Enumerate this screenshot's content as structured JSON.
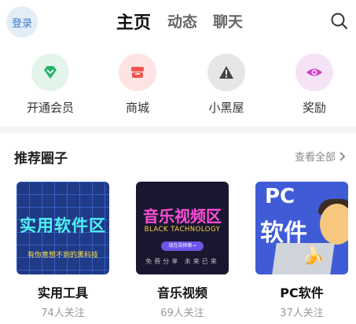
{
  "header": {
    "login_label": "登录",
    "tabs": [
      {
        "label": "主页",
        "active": true
      },
      {
        "label": "动态",
        "active": false
      },
      {
        "label": "聊天",
        "active": false
      }
    ],
    "search_icon": "search-icon"
  },
  "quick_actions": [
    {
      "label": "开通会员",
      "icon": "diamond-icon",
      "bg": "#e3f4ea",
      "color": "#27b36a"
    },
    {
      "label": "商城",
      "icon": "shop-icon",
      "bg": "#fde3e3",
      "color": "#f05454"
    },
    {
      "label": "小黑屋",
      "icon": "warning-icon",
      "bg": "#e6e6e6",
      "color": "#444444"
    },
    {
      "label": "奖励",
      "icon": "eye-icon",
      "bg": "#f5e3f5",
      "color": "#d23bc6"
    }
  ],
  "circles_section": {
    "title": "推荐圈子",
    "see_all": "查看全部",
    "items": [
      {
        "name": "实用工具",
        "followers": "74人关注",
        "thumb": {
          "title": "实用软件区",
          "subtitle": "有你意想不到的黑科技"
        }
      },
      {
        "name": "音乐视频",
        "followers": "69人关注",
        "thumb": {
          "title": "音乐视频区",
          "subtitle": "BLACK TACHNOLOGY",
          "button": "现在去探索→",
          "footer": "免费分享 未来已来"
        }
      },
      {
        "name": "PC软件",
        "followers": "37人关注",
        "thumb": {
          "title": "PC",
          "subtitle": "软件"
        }
      }
    ]
  }
}
